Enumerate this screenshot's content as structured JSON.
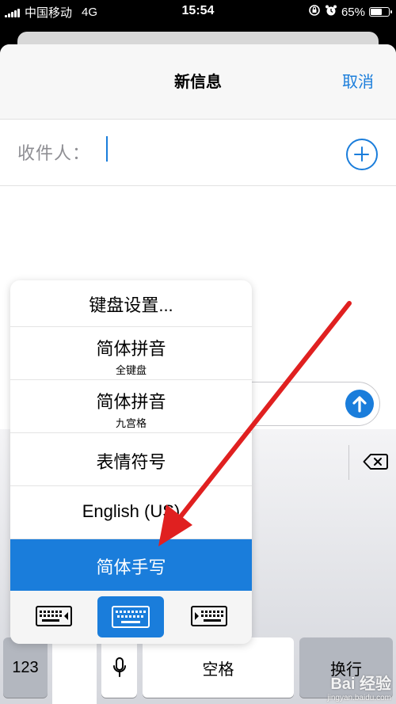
{
  "status_bar": {
    "carrier": "中国移动",
    "network": "4G",
    "time": "15:54",
    "battery": "65%",
    "battery_level": 0.65
  },
  "nav": {
    "title": "新信息",
    "cancel_label": "取消"
  },
  "recipient": {
    "label": "收件人："
  },
  "input_menu": {
    "items": [
      {
        "label": "键盘设置...",
        "sub": ""
      },
      {
        "label": "简体拼音",
        "sub": "全键盘"
      },
      {
        "label": "简体拼音",
        "sub": "九宫格"
      },
      {
        "label": "表情符号",
        "sub": ""
      },
      {
        "label": "English (US)",
        "sub": ""
      },
      {
        "label": "简体手写",
        "sub": "",
        "selected": true
      }
    ],
    "selected_color": "#1a7ddb"
  },
  "keyboard": {
    "numbers_label": "123",
    "space_label": "空格",
    "return_label": "换行"
  },
  "watermark": {
    "brand": "Bai 经验",
    "url": "jingyan.baidu.com"
  },
  "colors": {
    "accent": "#1a7ddb",
    "annotation_arrow": "#e02020"
  }
}
